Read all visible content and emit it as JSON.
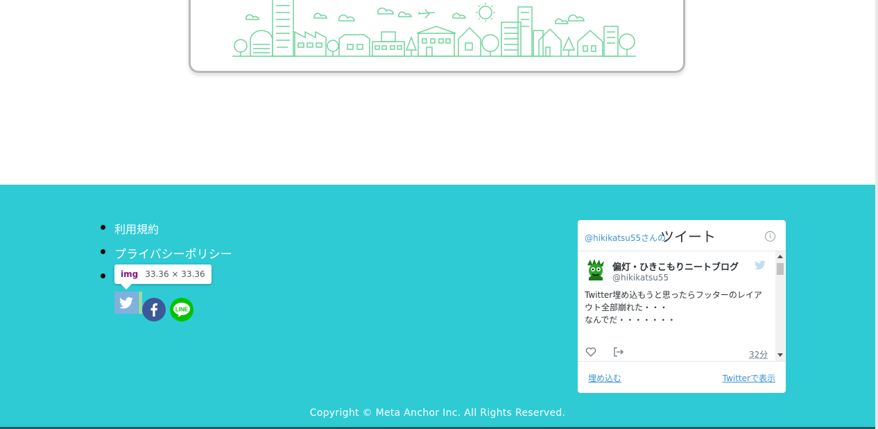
{
  "footer": {
    "links": [
      {
        "label": "利用規約"
      },
      {
        "label": "プライバシーポリシー"
      },
      {
        "label": ""
      }
    ],
    "copyright": "Copyright © Meta Anchor Inc. All Rights Reserved.",
    "background_color": "#2ecbd4"
  },
  "devtools_tooltip": {
    "tag": "img",
    "dimensions": "33.36 × 33.36"
  },
  "share_icons": [
    "twitter-icon",
    "facebook-icon",
    "line-icon"
  ],
  "line_icon_text": "LINE",
  "twitter_widget": {
    "header_user": "@hikikatsu55",
    "header_san": "さんの",
    "header_title": "ツイート",
    "info_glyph": "i",
    "tweet": {
      "author_name": "偏灯・ひきこもりニートブログ",
      "author_handle": "@hikikatsu55",
      "text_lines": [
        "Twitter埋め込もうと思ったらフッターのレイア",
        "ウト全部崩れた・・・",
        "なんでだ・・・・・・・"
      ],
      "time": "32分"
    },
    "embed_label": "埋め込む",
    "view_label": "Twitterで表示"
  }
}
